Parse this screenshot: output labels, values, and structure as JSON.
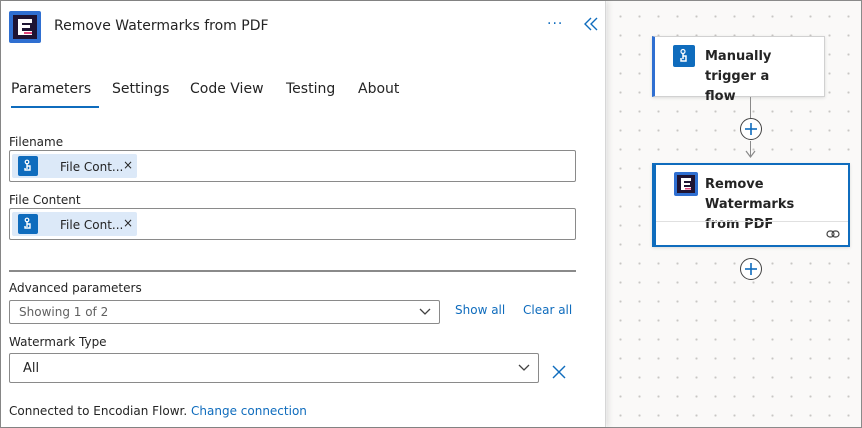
{
  "panel": {
    "title": "Remove Watermarks from PDF",
    "more": "···",
    "tabs": [
      "Parameters",
      "Settings",
      "Code View",
      "Testing",
      "About"
    ],
    "active_tab": "Parameters"
  },
  "parameters": {
    "filename": {
      "label": "Filename",
      "token": "File Cont...",
      "remove": "×"
    },
    "file_content": {
      "label": "File Content",
      "token": "File Cont...",
      "remove": "×"
    },
    "advanced": {
      "label": "Advanced parameters",
      "value": "Showing 1 of 2",
      "show_all": "Show all",
      "clear_all": "Clear all"
    },
    "watermark_type": {
      "label": "Watermark Type",
      "value": "All"
    },
    "connection": {
      "text": "Connected to Encodian Flowr.",
      "link": "Change connection"
    }
  },
  "canvas": {
    "trigger_card": {
      "title_line1": "Manually trigger a",
      "title_line2": "flow"
    },
    "action_card": {
      "title_line1": "Remove Watermarks",
      "title_line2": "from PDF"
    }
  },
  "colors": {
    "accent": "#0f6cbd",
    "token_bg": "#dce9f8",
    "logo_dark": "#1e1433"
  }
}
